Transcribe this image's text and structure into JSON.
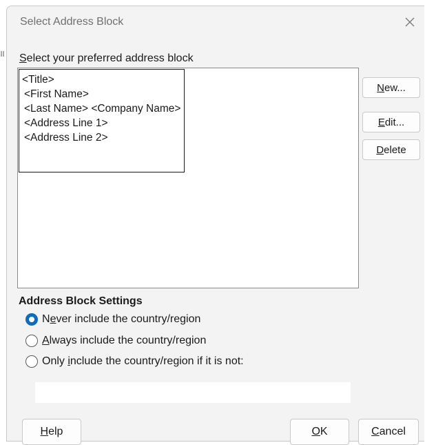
{
  "dialog": {
    "title": "Select Address Block",
    "close_icon": "close-icon"
  },
  "address_list": {
    "label": "&Select your preferred address block",
    "preview_lines": [
      "<Title>",
      "<First Name>",
      "<Last Name> <Company Name>",
      "<Address Line 1>",
      "<Address Line 2>"
    ]
  },
  "buttons": {
    "new": "&New...",
    "edit": "&Edit...",
    "delete": "&Delete",
    "help": "&Help",
    "ok": "&OK",
    "cancel": "&Cancel"
  },
  "settings": {
    "heading": "Address Block Settings",
    "options": [
      {
        "label": "N&ever include the country/region",
        "checked": true
      },
      {
        "label": "&Always include the country/region",
        "checked": false
      },
      {
        "label": "Only &include the country/region if it is not:",
        "checked": false
      }
    ],
    "country_value": ""
  },
  "colors": {
    "accent": "#0f6cbd",
    "dialog_bg": "#f3f3f3"
  }
}
